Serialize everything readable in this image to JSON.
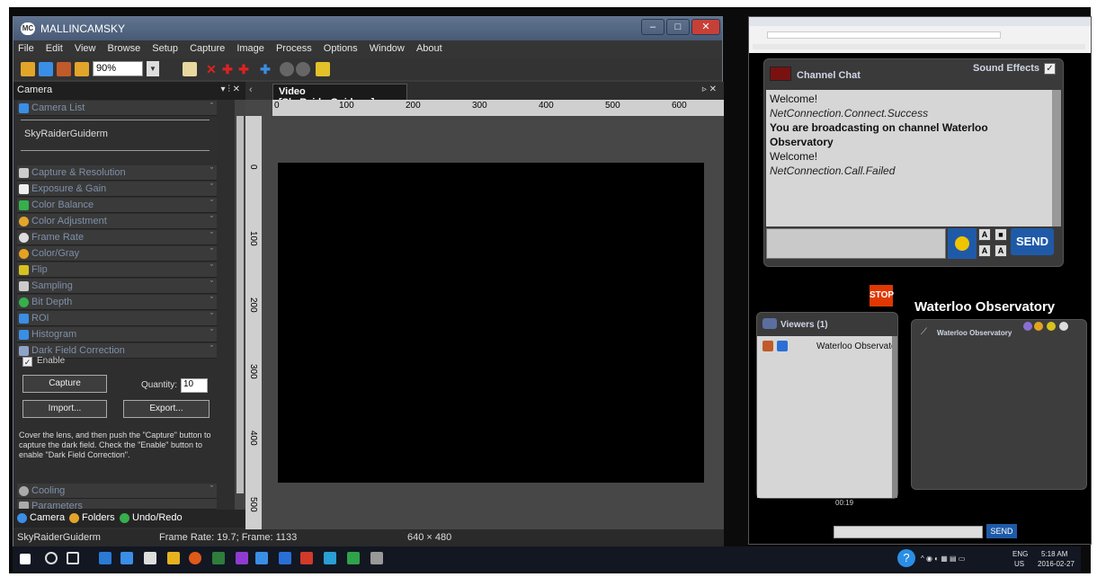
{
  "app": {
    "title": "MALLINCAMSKY",
    "icon_label": "MC",
    "menu": [
      "File",
      "Edit",
      "View",
      "Browse",
      "Setup",
      "Capture",
      "Image",
      "Process",
      "Options",
      "Window",
      "About"
    ],
    "zoom": "90%"
  },
  "left_panel": {
    "header": "Camera",
    "header_controls": "▾ ⫶ ✕",
    "sections": [
      {
        "label": "Camera List",
        "icon_color": "#3a8ee6"
      },
      {
        "label": "Capture & Resolution",
        "icon_color": "#cccccc"
      },
      {
        "label": "Exposure & Gain",
        "icon_color": "#eeeeee"
      },
      {
        "label": "Color Balance",
        "icon_color": "#35b04a"
      },
      {
        "label": "Color Adjustment",
        "icon_color": "#e2a52a"
      },
      {
        "label": "Frame Rate",
        "icon_color": "#dddddd"
      },
      {
        "label": "Color/Gray",
        "icon_color": "#e6a21f"
      },
      {
        "label": "Flip",
        "icon_color": "#d6c21f"
      },
      {
        "label": "Sampling",
        "icon_color": "#cccccc"
      },
      {
        "label": "Bit Depth",
        "icon_color": "#35b04a"
      },
      {
        "label": "ROI",
        "icon_color": "#3a8ee6"
      },
      {
        "label": "Histogram",
        "icon_color": "#3a8ee6"
      },
      {
        "label": "Dark Field Correction",
        "icon_color": "#8fa3c8"
      }
    ],
    "camera_list_item": "SkyRaiderGuiderm",
    "dark_field": {
      "enable_label": "Enable",
      "capture_label": "Capture",
      "quantity_label": "Quantity:",
      "quantity_value": "10",
      "import_label": "Import...",
      "export_label": "Export...",
      "help_text": "Cover the lens, and then push the \"Capture\" button to capture the dark field. Check the \"Enable\" button to enable \"Dark Field Correction\"."
    },
    "lower_sections": [
      {
        "label": "Cooling",
        "icon_color": "#aaaaaa"
      },
      {
        "label": "Parameters",
        "icon_color": "#aaaaaa"
      }
    ],
    "bottom_tabs": [
      {
        "label": "Camera",
        "icon_color": "#3a8ee6"
      },
      {
        "label": "Folders",
        "icon_color": "#e2a52a"
      },
      {
        "label": "Undo/Redo",
        "icon_color": "#35b04a"
      }
    ]
  },
  "video": {
    "tab_label": "Video [SkyRaiderGuiderm]",
    "hruler": [
      "0",
      "100",
      "200",
      "300",
      "400",
      "500",
      "600"
    ],
    "vruler": [
      "0",
      "100",
      "200",
      "300",
      "400",
      "500"
    ]
  },
  "status": {
    "camera": "SkyRaiderGuiderm",
    "frame": "Frame Rate: 19.7; Frame: 1133",
    "resolution": "640 × 480"
  },
  "taskbar": {
    "tray_lang": "ENG",
    "tray_region": "US",
    "tray_time": "5:18 AM",
    "tray_date": "2016-02-27"
  },
  "chat": {
    "title": "Channel Chat",
    "sound_effects_label": "Sound Effects",
    "messages": [
      {
        "text": "Welcome!",
        "style": "normal"
      },
      {
        "text": "NetConnection.Connect.Success",
        "style": "italic"
      },
      {
        "text": "You are broadcasting on channel Waterloo Observatory",
        "style": "bold"
      },
      {
        "text": "Welcome!",
        "style": "normal"
      },
      {
        "text": "NetConnection.Call.Failed",
        "style": "italic"
      }
    ],
    "send_label": "SEND",
    "stop_label": "STOP",
    "channel_name": "Waterloo Observatory",
    "viewers_header": "Viewers (1)",
    "viewer_name": "Waterloo Observatory",
    "video_title": "Waterloo Observatory",
    "timer": "00:19",
    "bottom_send_label": "SEND"
  }
}
